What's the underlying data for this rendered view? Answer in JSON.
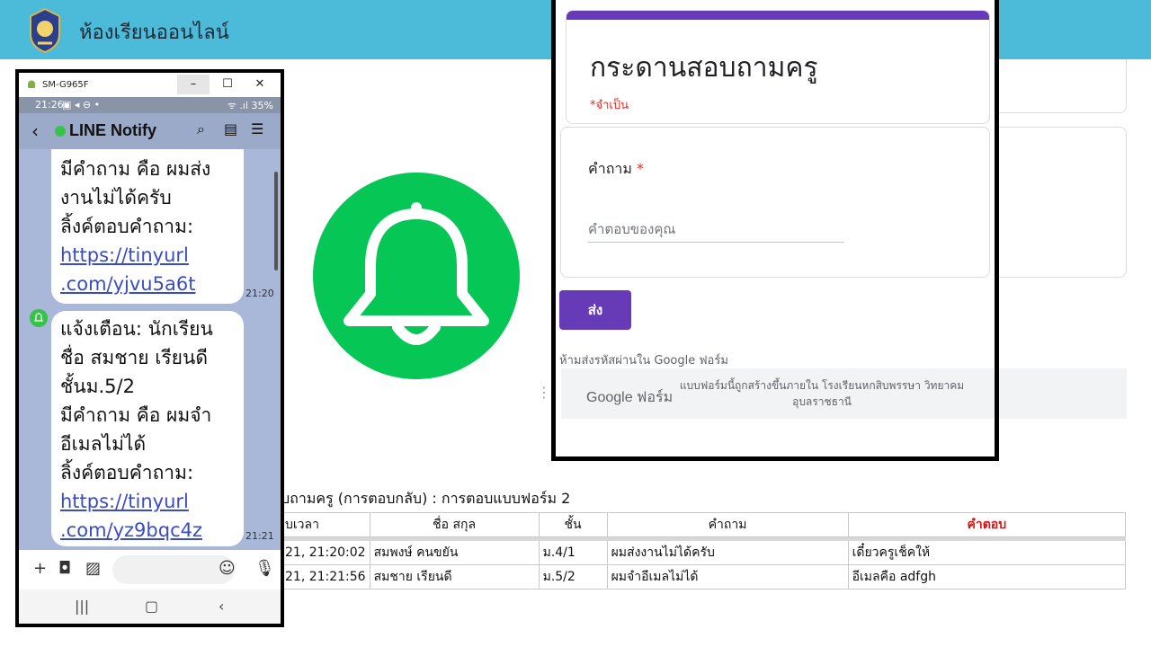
{
  "banner": {
    "title": "ห้องเรียนออนไลน์"
  },
  "phone": {
    "device": "SM-G965F",
    "window_controls": {
      "minimize": "–",
      "maximize": "☐",
      "close": "✕"
    },
    "status": {
      "time": "21:26",
      "icons": "▣ ◂ ⊖ •",
      "battery": "ᯤ .ıl 35%"
    },
    "chat_name": "LINE Notify",
    "messages": [
      {
        "lines": [
          " มีคำถาม คือ ผมส่ง",
          "งานไม่ได้ครับ",
          " ลิ้งค์ตอบคำถาม:"
        ],
        "link": [
          "https://tinyurl",
          ".com/yjvu5a6t"
        ],
        "time": "21:20"
      },
      {
        "lines": [
          "แจ้งเตือน: นักเรียน",
          "ชื่อ สมชาย เรียนดี",
          "ชั้นม.5/2",
          " มีคำถาม คือ ผมจำ",
          "อีเมลไม่ได้",
          " ลิ้งค์ตอบคำถาม:"
        ],
        "link": [
          "https://tinyurl",
          ".com/yz9bqc4z"
        ],
        "time": "21:21"
      }
    ]
  },
  "form": {
    "title": "กระดานสอบถามครู",
    "required_note": "*จำเป็น",
    "question_label": "คำถาม",
    "question_star": "*",
    "answer_placeholder": "คำตอบของคุณ",
    "submit_label": "ส่ง",
    "password_warning": "ห้ามส่งรหัสผ่านใน Google ฟอร์ม",
    "footer_brand": "Google ฟอร์ม",
    "footer_note": "แบบฟอร์มนี้ถูกสร้างขึ้นภายใน โรงเรียนหกสิบพรรษา วิทยาคม อุบลราชธานี"
  },
  "sheet": {
    "title": "บถามครู (การตอบกลับ) : การตอบแบบฟอร์ม 2",
    "headers": [
      "บเวลา",
      "ชื่อ สกุล",
      "ชั้น",
      "คำถาม",
      "คำตอบ"
    ],
    "rows": [
      [
        "21, 21:20:02",
        "สมพงษ์ คนขยัน",
        "ม.4/1",
        "ผมส่งงานไม่ได้ครับ",
        "เดี๋ยวครูเช็คให้"
      ],
      [
        "21, 21:21:56",
        "สมชาย เรียนดี",
        "ม.5/2",
        "ผมจำอีเมลไม่ได้",
        "อีเมลคือ adfgh"
      ]
    ]
  },
  "colors": {
    "banner": "#4bbbd9",
    "line_green": "#06c755",
    "form_purple": "#673ab7",
    "required_red": "#d93025"
  }
}
